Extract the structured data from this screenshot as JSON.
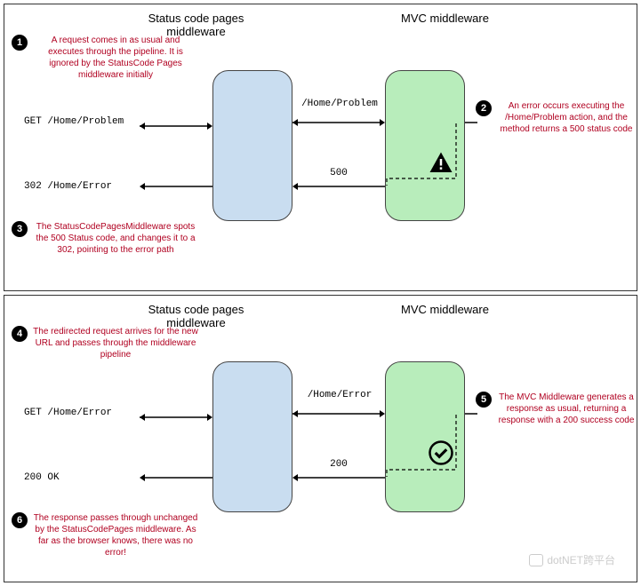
{
  "headers": {
    "status": "Status code pages middleware",
    "mvc": "MVC middleware"
  },
  "panel1": {
    "annot1": "A request comes in as usual and executes through the pipeline. It is ignored by the StatusCode Pages middleware initially",
    "annot2": "An error occurs executing the /Home/Problem action, and the method returns a 500 status code",
    "annot3": "The StatusCodePagesMiddleware spots the 500 Status code, and changes it to a 302, pointing to the error path",
    "req1": "GET /Home/Problem",
    "req2": "302 /Home/Error",
    "flow1": "/Home/Problem",
    "flow2": "500"
  },
  "panel2": {
    "annot4": "The redirected request arrives for the new URL and passes through the middleware pipeline",
    "annot5": "The MVC Middleware generates a response as usual, returning a response with a 200 success code",
    "annot6": "The response passes through unchanged by the StatusCodePages middleware. As far as the browser knows, there was no error!",
    "req1": "GET /Home/Error",
    "req2": "200 OK",
    "flow1": "/Home/Error",
    "flow2": "200"
  },
  "watermark": "dotNET跨平台"
}
